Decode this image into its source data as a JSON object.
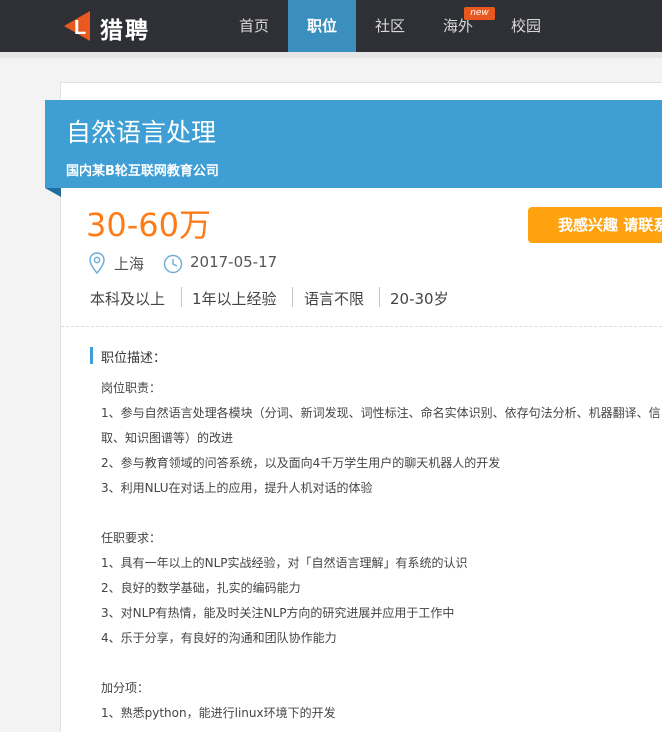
{
  "nav": {
    "logo_text": "猎聘",
    "items": [
      {
        "label": "首页",
        "active": false
      },
      {
        "label": "职位",
        "active": true
      },
      {
        "label": "社区",
        "active": false
      },
      {
        "label": "海外",
        "active": false
      },
      {
        "label": "校园",
        "active": false
      }
    ],
    "badge": "new",
    "active_color": "#3b8fbe"
  },
  "job": {
    "title": "自然语言处理",
    "company": "国内某B轮互联网教育公司",
    "salary": "30-60万",
    "apply_label": "我感兴趣 请联系",
    "location": "上海",
    "date": "2017-05-17",
    "requirements": [
      "本科及以上",
      "1年以上经验",
      "语言不限",
      "20-30岁"
    ]
  },
  "description": {
    "section_title": "职位描述：",
    "lines": [
      "岗位职责：",
      "1、参与自然语言处理各模块（分词、新词发现、词性标注、命名实体识别、依存句法分析、机器翻译、信",
      "取、知识图谱等）的改进",
      "2、参与教育领域的问答系统，以及面向4千万学生用户的聊天机器人的开发",
      "3、利用NLU在对话上的应用，提升人机对话的体验",
      "",
      "任职要求：",
      "1、具有一年以上的NLP实战经验，对「自然语言理解」有系统的认识",
      "2、良好的数学基础，扎实的编码能力",
      "3、对NLP有热情，能及时关注NLP方向的研究进展并应用于工作中",
      "4、乐于分享，有良好的沟通和团队协作能力",
      "",
      "加分项：",
      "1、熟悉python，能进行linux环境下的开发"
    ]
  },
  "colors": {
    "banner": "#3f9ed3",
    "salary": "#ff7b18",
    "apply": "#ffa20f",
    "nav_bg": "#2e3035"
  }
}
